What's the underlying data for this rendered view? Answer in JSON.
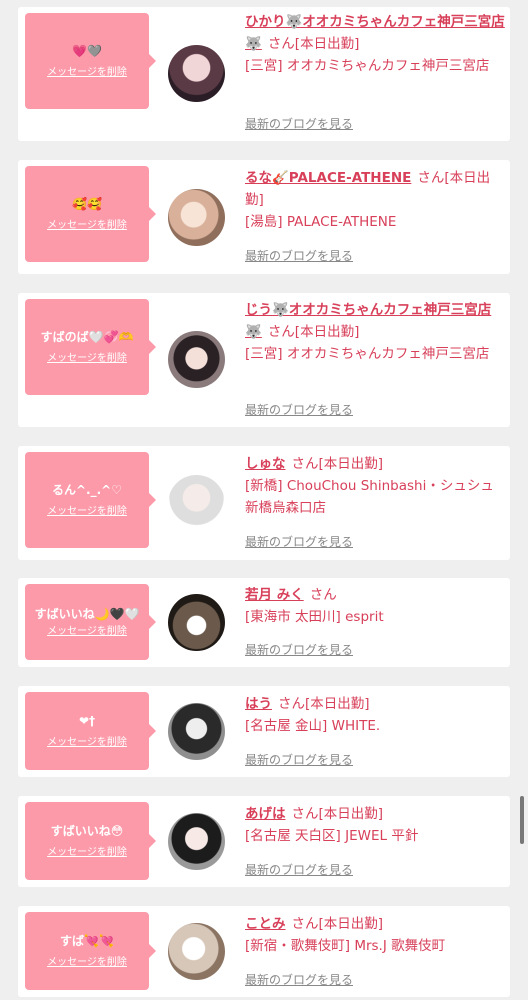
{
  "common": {
    "delete_label": "メッセージを削除",
    "blog_label": "最新のブログを見る"
  },
  "items": [
    {
      "message": "💗🩶",
      "name": "ひかり🐺オオカミちゃんカフェ神戸三宮店🐺",
      "suffix": "さん[本日出勤]",
      "shop": "[三宮] オオカミちゃんカフェ神戸三宮店"
    },
    {
      "message": "🥰🥰",
      "name": "るな🎸PALACE-ATHENE",
      "suffix": "さん[本日出勤]",
      "shop": "[湯島] PALACE-ATHENE"
    },
    {
      "message": "すばのば🤍💞🫶",
      "name": "じう🐺オオカミちゃんカフェ神戸三宮店🐺",
      "suffix": "さん[本日出勤]",
      "shop": "[三宮] オオカミちゃんカフェ神戸三宮店"
    },
    {
      "message": "るん^._.^♡",
      "name": "しゅな",
      "suffix": "さん[本日出勤]",
      "shop": "[新橋] ChouChou Shinbashi・シュシュ新橋烏森口店"
    },
    {
      "message": "すばいいね🌙🖤🤍",
      "name": "若月 みく",
      "suffix": "さん",
      "shop": "[東海市 太田川] esprit"
    },
    {
      "message": "❤︎†",
      "name": "はう",
      "suffix": "さん[本日出勤]",
      "shop": "[名古屋 金山] WHITE."
    },
    {
      "message": "すばいいね😳",
      "name": "あげは",
      "suffix": "さん[本日出勤]",
      "shop": "[名古屋 天白区] JEWEL 平針"
    },
    {
      "message": "すば💘💘",
      "name": "ことみ",
      "suffix": "さん[本日出勤]",
      "shop": "[新宿・歌舞伎町] Mrs.J 歌舞伎町"
    }
  ]
}
